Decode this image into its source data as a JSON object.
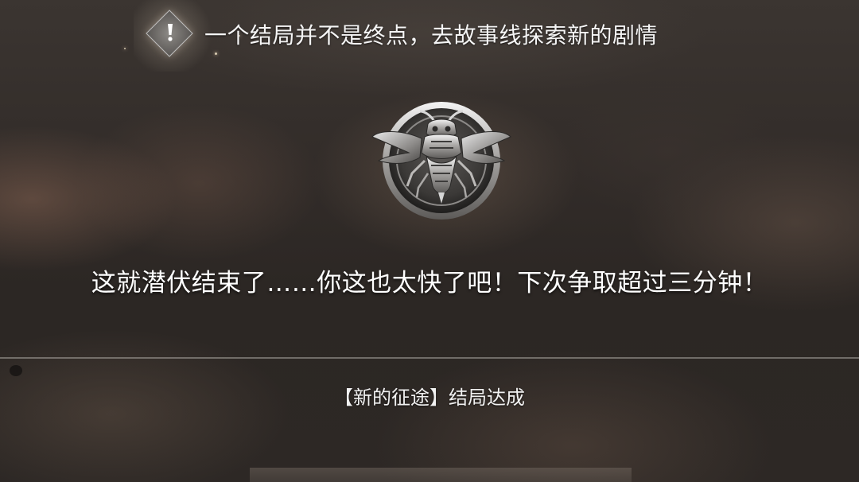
{
  "hint": {
    "icon": "exclamation-diamond-icon",
    "text": "一个结局并不是终点，去故事线探索新的剧情"
  },
  "emblem": {
    "icon": "wasp-emblem-icon"
  },
  "message": "这就潜伏结束了……你这也太快了吧！下次争取超过三分钟！",
  "achievement": "【新的征途】结局达成",
  "colors": {
    "text": "#f5f5f5",
    "divider": "#aaa5a0",
    "background": "#322c29"
  }
}
